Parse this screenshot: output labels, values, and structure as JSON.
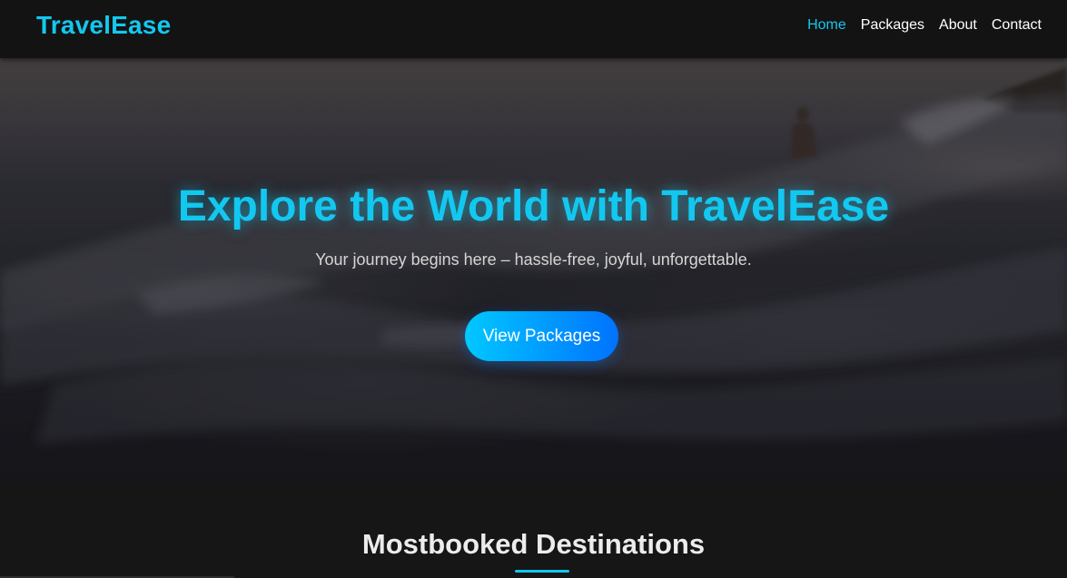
{
  "navbar": {
    "brand": "TravelEase",
    "links": [
      {
        "label": "Home",
        "active": true
      },
      {
        "label": "Packages",
        "active": false
      },
      {
        "label": "About",
        "active": false
      },
      {
        "label": "Contact",
        "active": false
      }
    ]
  },
  "hero": {
    "title": "Explore the World with TravelEase",
    "subtitle": "Your journey begins here – hassle-free, joyful, unforgettable.",
    "cta_label": "View Packages"
  },
  "destinations": {
    "title": "Mostbooked Destinations"
  },
  "colors": {
    "accent": "#12c8f0",
    "navbar_bg": "#131313",
    "page_bg": "#161616",
    "button_gradient_start": "#00c8ff",
    "button_gradient_end": "#0072ff"
  }
}
